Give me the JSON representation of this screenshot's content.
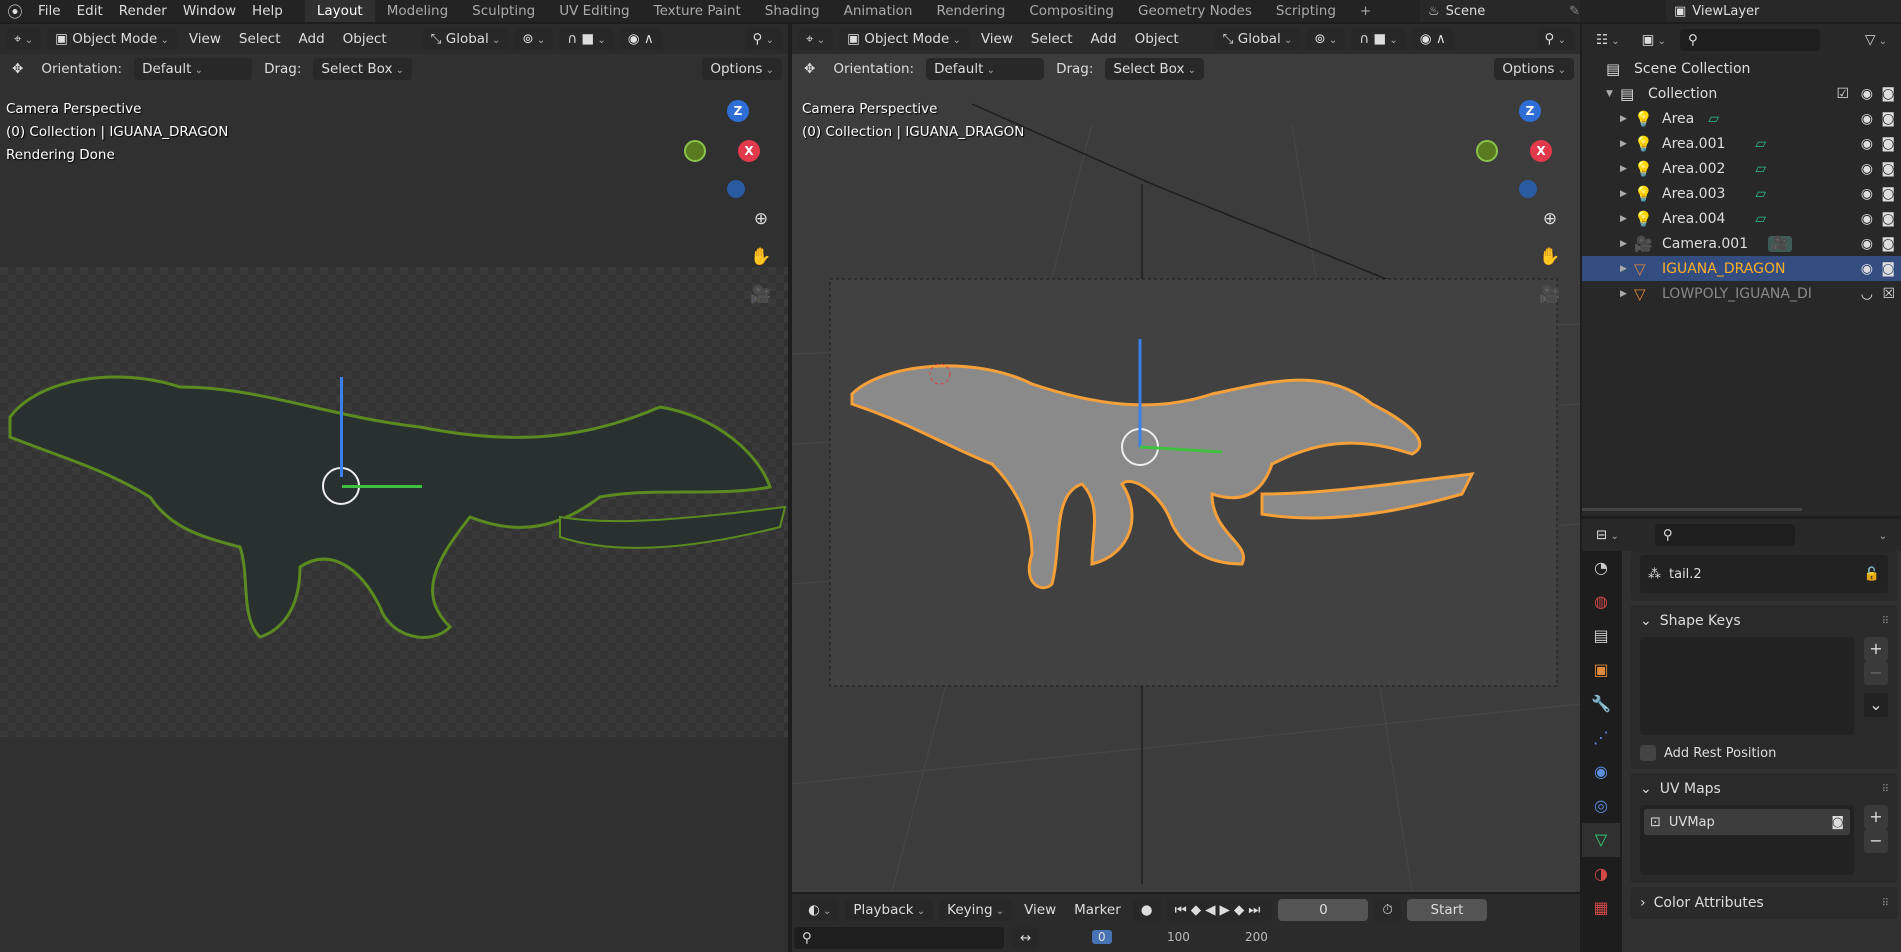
{
  "menu": [
    "File",
    "Edit",
    "Render",
    "Window",
    "Help"
  ],
  "workspaces": [
    "Layout",
    "Modeling",
    "Sculpting",
    "UV Editing",
    "Texture Paint",
    "Shading",
    "Animation",
    "Rendering",
    "Compositing",
    "Geometry Nodes",
    "Scripting",
    "+"
  ],
  "scene": "Scene",
  "view_layer": "ViewLayer",
  "viewport_left": {
    "mode": "Object Mode",
    "menus": [
      "View",
      "Select",
      "Add",
      "Object"
    ],
    "transform": "Global",
    "orientation_label": "Orientation:",
    "orientation": "Default",
    "drag_label": "Drag:",
    "drag": "Select Box",
    "options": "Options",
    "overlay": [
      "Camera Perspective",
      "(0) Collection | IGUANA_DRAGON",
      "Rendering Done"
    ]
  },
  "viewport_main": {
    "mode": "Object Mode",
    "menus": [
      "View",
      "Select",
      "Add",
      "Object"
    ],
    "transform": "Global",
    "orientation_label": "Orientation:",
    "orientation": "Default",
    "drag_label": "Drag:",
    "drag": "Select Box",
    "options": "Options",
    "overlay": [
      "Camera Perspective",
      "(0) Collection | IGUANA_DRAGON"
    ]
  },
  "gizmo": {
    "z": "Z",
    "x": "X"
  },
  "outliner": {
    "root": "Scene Collection",
    "collection": "Collection",
    "items": [
      {
        "name": "Area",
        "type": "light"
      },
      {
        "name": "Area.001",
        "type": "light"
      },
      {
        "name": "Area.002",
        "type": "light"
      },
      {
        "name": "Area.003",
        "type": "light"
      },
      {
        "name": "Area.004",
        "type": "light"
      },
      {
        "name": "Camera.001",
        "type": "camera"
      },
      {
        "name": "IGUANA_DRAGON",
        "type": "mesh",
        "selected": true
      },
      {
        "name": "LOWPOLY_IGUANA_DI",
        "type": "mesh",
        "hidden": true
      }
    ]
  },
  "properties": {
    "vertex_group": "tail.2",
    "shape_keys": "Shape Keys",
    "add_rest_position": "Add Rest Position",
    "uv_maps": "UV Maps",
    "uv_map_item": "UVMap",
    "color_attributes": "Color Attributes"
  },
  "timeline": {
    "menus": [
      "Playback",
      "Keying",
      "View",
      "Marker"
    ],
    "frame": "0",
    "start_label": "Start",
    "ticks": [
      "0",
      "100",
      "200"
    ]
  },
  "colors": {
    "accent": "#4772b3",
    "selected_text": "#ffaf29",
    "outline": "#f5a03a"
  }
}
